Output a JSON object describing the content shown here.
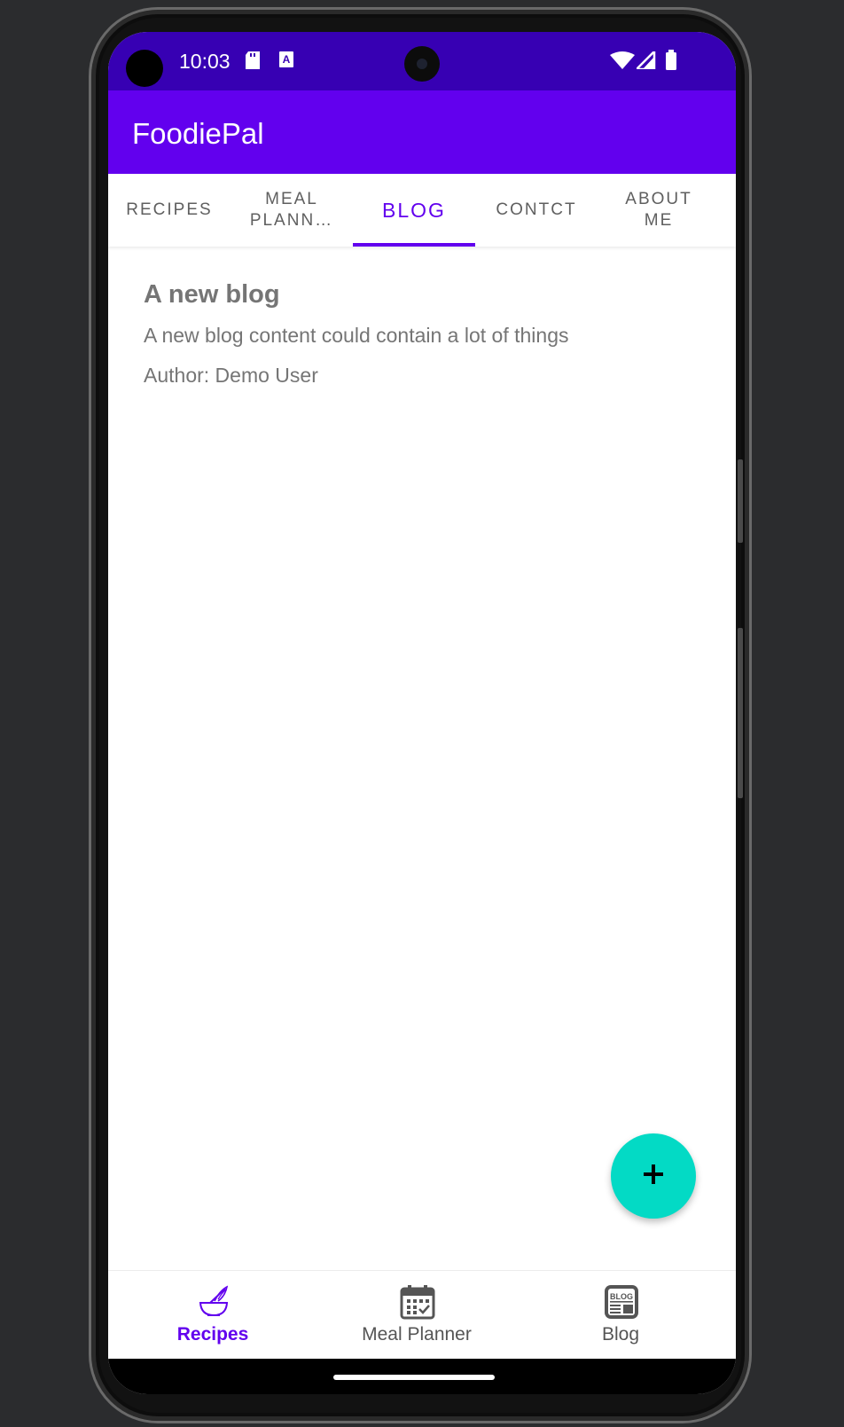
{
  "status_bar": {
    "time": "10:03",
    "icons": [
      "sd-card-icon",
      "keyboard-a-icon",
      "wifi-icon",
      "signal-icon",
      "battery-icon"
    ]
  },
  "app_bar": {
    "title": "FoodiePal"
  },
  "tabs": [
    {
      "label": "RECIPES",
      "active": false
    },
    {
      "label": "MEAL PLANN…",
      "active": false
    },
    {
      "label": "BLOG",
      "active": true
    },
    {
      "label": "CONTCT",
      "active": false
    },
    {
      "label": "ABOUT ME",
      "active": false
    }
  ],
  "blog": {
    "title": "A new blog",
    "content": "A new blog content could contain a lot of things",
    "author": "Author: Demo User"
  },
  "fab": {
    "icon": "plus-icon"
  },
  "bottom_nav": [
    {
      "label": "Recipes",
      "icon": "bowl-whisk-icon",
      "active": true
    },
    {
      "label": "Meal Planner",
      "icon": "calendar-icon",
      "active": false
    },
    {
      "label": "Blog",
      "icon": "blog-icon",
      "active": false
    }
  ],
  "colors": {
    "primary": "#6200ee",
    "primary_dark": "#3700b3",
    "accent": "#03dac5"
  }
}
